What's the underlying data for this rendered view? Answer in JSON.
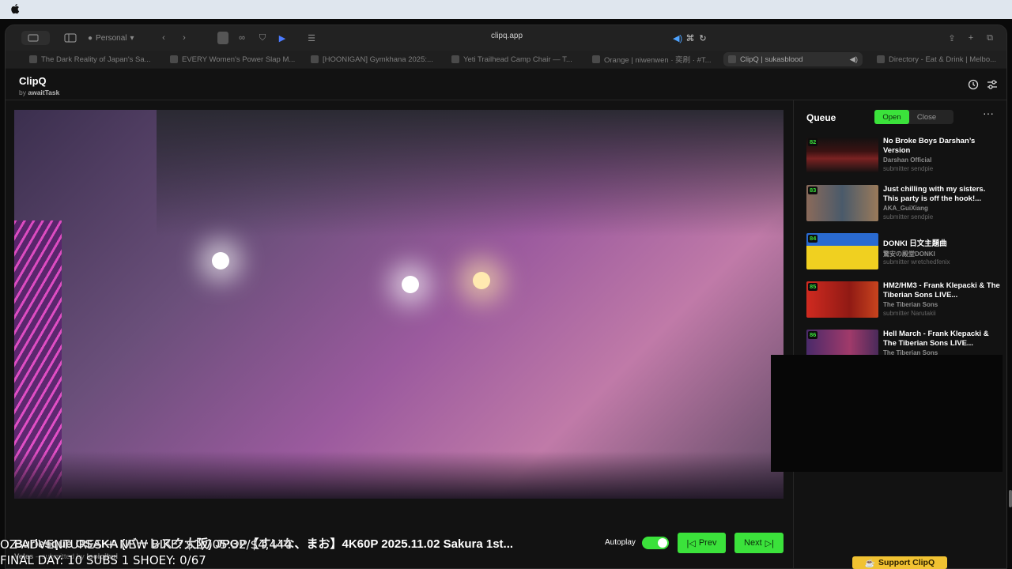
{
  "browser": {
    "profile_label": "Personal",
    "address": "clipq.app",
    "tabs": [
      {
        "label": "The Dark Reality of Japan's Sa..."
      },
      {
        "label": "EVERY Women's Power Slap M..."
      },
      {
        "label": "[HOONIGAN] Gymkhana 2025:..."
      },
      {
        "label": "Yeti Trailhead Camp Chair — T..."
      },
      {
        "label": "Orange | niwenwen · 奕刷 · #T..."
      },
      {
        "label": "ClipQ | sukasblood",
        "active": true
      },
      {
        "label": "Directory - Eat & Drink | Melbo..."
      }
    ]
  },
  "app": {
    "brand": "ClipQ",
    "brand_by": "by",
    "brand_author": "awaitTask"
  },
  "video": {
    "title": "Burlesque OSAKA (バーレスク大阪) JPOP【すいな、まお】4K60P 2025.11.02 Sakura 1st...",
    "channel": "Veles",
    "submitted_by_label": "submitted by",
    "submitter": "looiqihui"
  },
  "controls": {
    "autoplay_label": "Autoplay",
    "autoplay_on": true,
    "prev_label": "Prev",
    "next_label": "Next"
  },
  "queue": {
    "title": "Queue",
    "open_label": "Open",
    "close_label": "Close",
    "items": [
      {
        "num": "82",
        "title": "No Broke Boys Darshan’s Version",
        "channel": "Darshan Official",
        "submitter": "submitter sendpie",
        "thumb": "#2a0f0f"
      },
      {
        "num": "83",
        "title": "Just chilling with my sisters. This party is off the hook!...",
        "channel": "AKA_GuiXiang",
        "submitter": "submitter sendpie",
        "thumb": "#6b5a4a"
      },
      {
        "num": "84",
        "title": "DONKI 日文主題曲",
        "channel": "驚安の殿堂DONKI",
        "submitter": "submitter wretchedfenix",
        "thumb": "#e6c11f"
      },
      {
        "num": "85",
        "title": "HM2/HM3 - Frank Klepacki & The Tiberian Sons LIVE...",
        "channel": "The Tiberian Sons",
        "submitter": "submitter Narutakii",
        "thumb": "#b0201a"
      },
      {
        "num": "86",
        "title": "Hell March - Frank Klepacki & The Tiberian Sons LIVE...",
        "channel": "The Tiberian Sons",
        "submitter": "",
        "thumb": "#5a2a5a"
      }
    ]
  },
  "support_label": "Support ClipQ",
  "stream_overlay": {
    "line1": "OZ ADVENTURES + NEW BIKE: $1,705.32/$4,444",
    "line2": "FINAL DAY: 10 SUBS 1 SHOEY: 0/67"
  },
  "colors": {
    "accent_green": "#3be23b",
    "support_yellow": "#f1c232"
  }
}
